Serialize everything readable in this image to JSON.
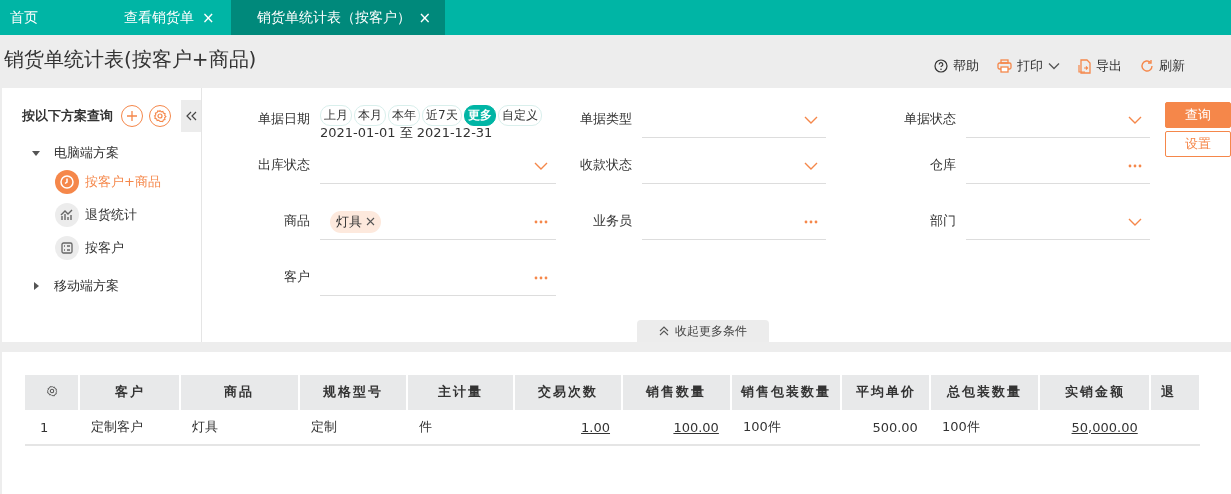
{
  "tabs": [
    {
      "label": "首页",
      "selected": false
    },
    {
      "label": "查看销货单",
      "selected": false,
      "close": "×"
    },
    {
      "label": "销货单统计表（按客户）",
      "selected": true,
      "close": "×"
    }
  ],
  "page_title": "销货单统计表(按客户+商品)",
  "toolbar": [
    {
      "label": "帮助",
      "has_menu": false
    },
    {
      "label": "打印",
      "has_menu": true
    },
    {
      "label": "导出",
      "has_menu": false
    },
    {
      "label": "刷新",
      "has_menu": false
    }
  ],
  "sidebar": {
    "title": "按以下方案查询",
    "groups": [
      {
        "label": "电脑端方案",
        "expanded": true,
        "children": [
          {
            "label": "按客户+商品",
            "selected": true
          },
          {
            "label": "退货统计",
            "selected": false
          },
          {
            "label": "按客户",
            "selected": false
          }
        ]
      },
      {
        "label": "移动端方案",
        "expanded": false
      }
    ]
  },
  "filters": [
    {
      "kind": "date",
      "label": "单据日期",
      "chips": [
        {
          "label": "上月",
          "selected": false
        },
        {
          "label": "本月",
          "selected": false
        },
        {
          "label": "本年",
          "selected": false
        },
        {
          "label": "近7天",
          "selected": false
        },
        {
          "label": "更多",
          "selected": true
        },
        {
          "label": "自定义",
          "selected": false
        }
      ],
      "range": "2021-01-01 至 2021-12-31"
    },
    {
      "kind": "select",
      "label": "单据类型"
    },
    {
      "kind": "select",
      "label": "单据状态"
    },
    {
      "kind": "select",
      "label": "出库状态"
    },
    {
      "kind": "select",
      "label": "收款状态"
    },
    {
      "kind": "picker",
      "label": "仓库"
    },
    {
      "kind": "picker",
      "label": "商品",
      "tags": [
        "灯具"
      ]
    },
    {
      "kind": "picker",
      "label": "业务员"
    },
    {
      "kind": "select",
      "label": "部门"
    },
    {
      "kind": "picker",
      "label": "客户"
    }
  ],
  "query_button": "查询",
  "settings_button": "设置",
  "collapse_label": "收起更多条件",
  "table": {
    "columns": [
      "客户",
      "商品",
      "规格型号",
      "主计量",
      "交易次数",
      "销售数量",
      "销售包装数量",
      "平均单价",
      "总包装数量",
      "实销金额",
      "退"
    ],
    "rows": [
      {
        "index": "1",
        "cells": [
          {
            "text": "定制客户",
            "link": false
          },
          {
            "text": "灯具",
            "link": false
          },
          {
            "text": "定制",
            "link": false
          },
          {
            "text": "件",
            "link": false
          },
          {
            "text": "1.00",
            "link": true
          },
          {
            "text": "100.00",
            "link": true
          },
          {
            "text": "100件",
            "link": false
          },
          {
            "text": "500.00",
            "link": false
          },
          {
            "text": "100件",
            "link": false
          },
          {
            "text": "50,000.00",
            "link": true
          }
        ]
      }
    ]
  }
}
